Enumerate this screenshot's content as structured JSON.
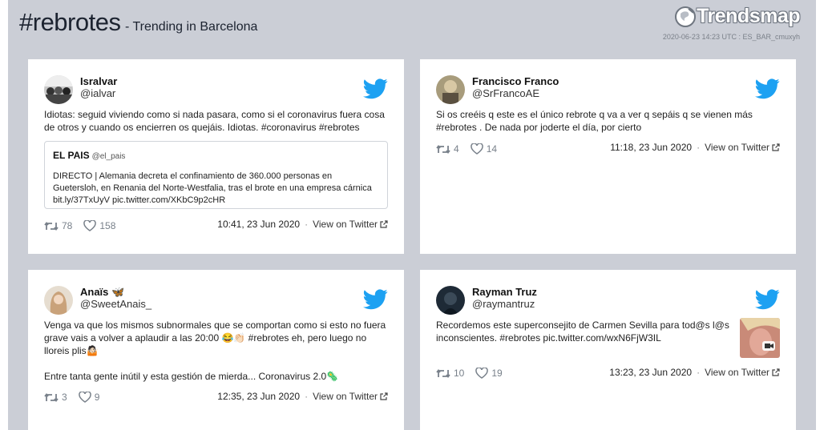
{
  "header": {
    "title": "#rebrotes",
    "subtitle": "- Trending in Barcelona",
    "logo": "Trendsmap",
    "meta": "2020-06-23 14:23 UTC : ES_BAR_cmuxyh"
  },
  "colors": {
    "twitter_blue": "#1da1f2",
    "background": "#cbced6"
  },
  "view_label": "View on Twitter",
  "tweets": [
    {
      "name": "Isralvar",
      "handle": "@ialvar",
      "text": "Idiotas: seguid viviendo como si nada pasara, como si el coronavirus fuera cosa de otros y cuando os encierren os quejáis. Idiotas. #coronavirus #rebrotes",
      "quote": {
        "name": "EL PAIS",
        "handle": "@el_pais",
        "text": "DIRECTO | Alemania decreta el confinamiento de 360.000 personas en Guetersloh, en Renania del Norte-Westfalia, tras el brote en una empresa cárnica bit.ly/37TxUyV pic.twitter.com/XKbC9p2cHR"
      },
      "retweets": "78",
      "likes": "158",
      "time": "10:41, 23 Jun 2020"
    },
    {
      "name": "Francisco Franco",
      "handle": "@SrFrancoAE",
      "text": "Si os creéis q este es el único rebrote q va a ver q sepáis q se vienen más #rebrotes . De nada por joderte el día, por cierto",
      "retweets": "4",
      "likes": "14",
      "time": "11:18, 23 Jun 2020"
    },
    {
      "name": "Anaïs 🦋",
      "handle": "@SweetAnais_",
      "text": "Venga va que los mismos subnormales que se comportan como si esto no fuera grave vais a volver a aplaudir a las 20:00 😂👏🏻 #rebrotes eh, pero luego no lloreis plis🤷🏻\n\nEntre tanta gente inútil y esta gestión de mierda... Coronavirus 2.0🦠",
      "retweets": "3",
      "likes": "9",
      "time": "12:35, 23 Jun 2020"
    },
    {
      "name": "Rayman Truz",
      "handle": "@raymantruz",
      "text": "Recordemos este superconsejito de Carmen Sevilla para tod@s l@s inconscientes. #rebrotes pic.twitter.com/wxN6FjW3IL",
      "retweets": "10",
      "likes": "19",
      "time": "13:23, 23 Jun 2020",
      "media": "video-thumbnail"
    }
  ]
}
